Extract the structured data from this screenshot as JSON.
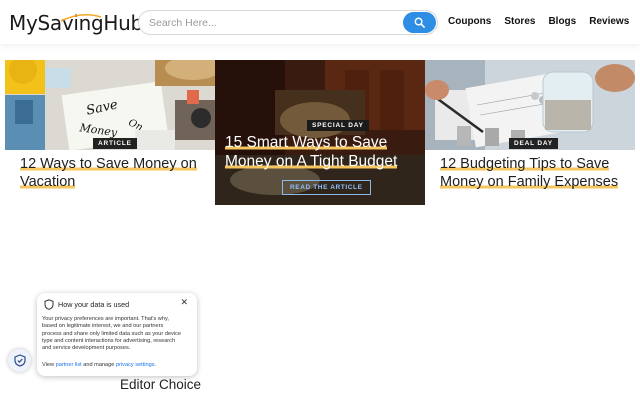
{
  "header": {
    "logo": "MySavingHub",
    "search_placeholder": "Search Here...",
    "nav": [
      "Coupons",
      "Stores",
      "Blogs",
      "Reviews"
    ]
  },
  "cards": [
    {
      "badge": "ARTICLE",
      "title": "12 Ways to Save Money on Vacation"
    },
    {
      "badge": "DEAL DAY",
      "title": "12 Budgeting Tips to Save Money on Family Expenses"
    }
  ],
  "feature": {
    "badge": "SPECIAL DAY",
    "title": "15 Smart Ways to Save Money on A Tight Budget",
    "button": "READ THE ARTICLE"
  },
  "privacy": {
    "title": "How your data is used",
    "body": "Your privacy preferences are important. That's why, based on legitimate interest, we and our partners process and share only limited data such as your device type and content interactions for advertising, research and service development purposes.",
    "foot_prefix": "View",
    "partner_link": "partner list",
    "foot_mid": "and manage",
    "settings_link": "privacy settings",
    "foot_end": "."
  },
  "section_title": "Editor Choice",
  "colors": {
    "accent": "#2e8de4",
    "highlight": "#f6c55e"
  }
}
